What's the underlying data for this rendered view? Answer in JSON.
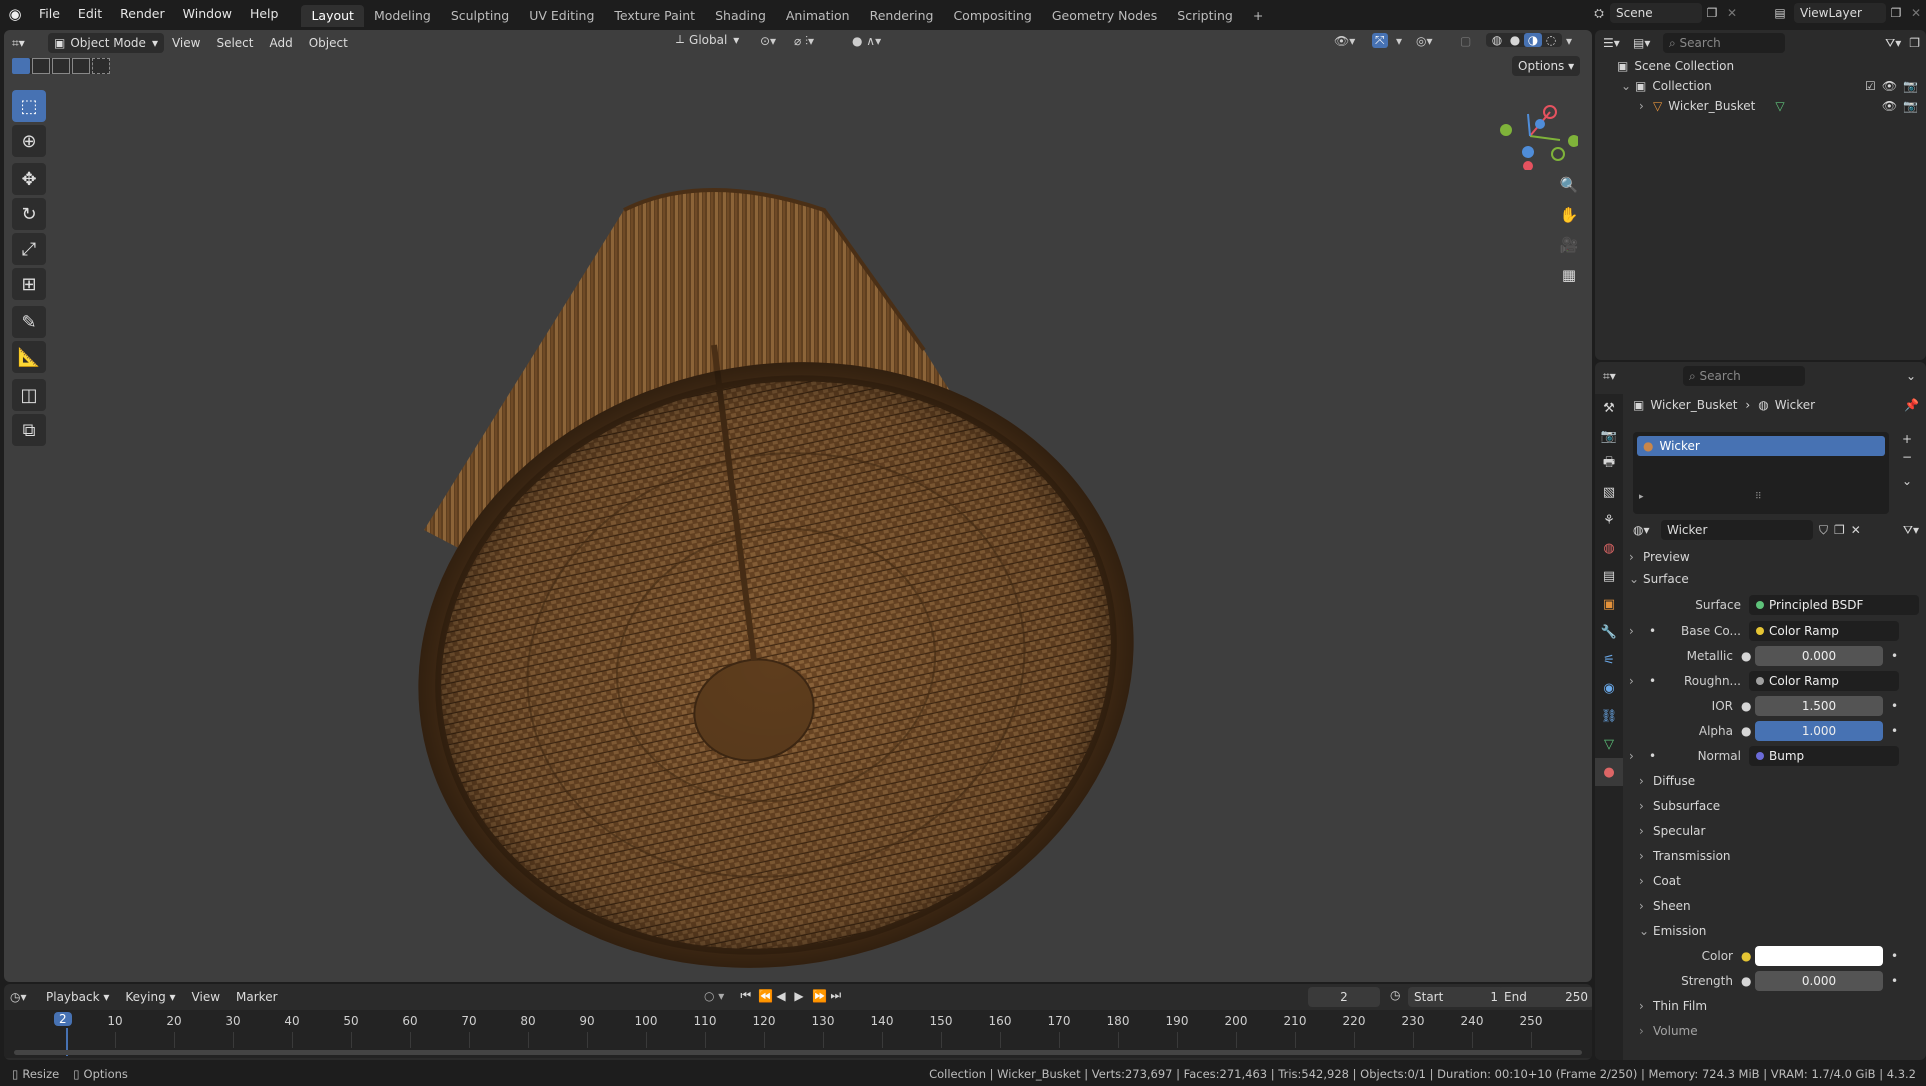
{
  "top_menu": [
    "File",
    "Edit",
    "Render",
    "Window",
    "Help"
  ],
  "workspace_tabs": [
    "Layout",
    "Modeling",
    "Sculpting",
    "UV Editing",
    "Texture Paint",
    "Shading",
    "Animation",
    "Rendering",
    "Compositing",
    "Geometry Nodes",
    "Scripting"
  ],
  "active_workspace": "Layout",
  "scene_name": "Scene",
  "view_layer": "ViewLayer",
  "viewport": {
    "mode": "Object Mode",
    "menus": [
      "View",
      "Select",
      "Add",
      "Object"
    ],
    "transform_orientation": "Global",
    "options_label": "Options"
  },
  "outliner": {
    "search_placeholder": "Search",
    "scene_collection": "Scene Collection",
    "collection": "Collection",
    "object": "Wicker_Busket"
  },
  "properties": {
    "search_placeholder": "Search",
    "breadcrumb_object": "Wicker_Busket",
    "breadcrumb_material": "Wicker",
    "material_slot": "Wicker",
    "material_name": "Wicker",
    "sections": {
      "preview": "Preview",
      "surface": "Surface"
    },
    "surface_label": "Surface",
    "surface_value": "Principled BSDF",
    "rows": [
      {
        "label": "Base Co...",
        "value": "Color Ramp"
      },
      {
        "label": "Metallic",
        "value": "0.000"
      },
      {
        "label": "Roughn...",
        "value": "Color Ramp"
      },
      {
        "label": "IOR",
        "value": "1.500"
      },
      {
        "label": "Alpha",
        "value": "1.000"
      },
      {
        "label": "Normal",
        "value": "Bump"
      }
    ],
    "subsections": [
      "Diffuse",
      "Subsurface",
      "Specular",
      "Transmission",
      "Coat",
      "Sheen",
      "Emission"
    ],
    "emission_color_label": "Color",
    "emission_strength_label": "Strength",
    "emission_strength_value": "0.000",
    "thin_film": "Thin Film",
    "volume": "Volume"
  },
  "timeline": {
    "menus": [
      "Playback",
      "Keying",
      "View",
      "Marker"
    ],
    "current_frame": "2",
    "start_label": "Start",
    "start_value": "1",
    "end_label": "End",
    "end_value": "250",
    "ticks": [
      "10",
      "20",
      "30",
      "40",
      "50",
      "60",
      "70",
      "80",
      "90",
      "100",
      "110",
      "120",
      "130",
      "140",
      "150",
      "160",
      "170",
      "180",
      "190",
      "200",
      "210",
      "220",
      "230",
      "240",
      "250"
    ],
    "playhead_label": "2"
  },
  "statusbar": {
    "left1": "Resize",
    "left2": "Options",
    "info": "Collection | Wicker_Busket | Verts:273,697 | Faces:271,463 | Tris:542,928 | Objects:0/1 | Duration: 00:10+10 (Frame 2/250) | Memory: 724.3 MiB | VRAM: 1.7/4.0 GiB | 4.3.2"
  },
  "colors": {
    "accent": "#4772b3",
    "viewport_bg": "#3e3e3e",
    "wicker": "#7a5530"
  }
}
